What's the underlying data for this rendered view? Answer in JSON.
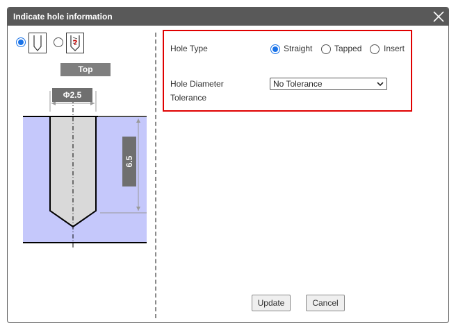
{
  "dialog": {
    "title": "Indicate hole information",
    "close_icon": "close-icon"
  },
  "left_panel": {
    "view_options": [
      {
        "icon": "straight-hole-icon",
        "selected": true
      },
      {
        "icon": "tapped-hole-icon",
        "selected": false
      }
    ],
    "view_label": "Top",
    "diameter_label": "Φ2.5",
    "depth_label": "6.5",
    "colors": {
      "material": "#c5c8fb",
      "hole": "#d9d9d9"
    }
  },
  "hole_type": {
    "label": "Hole Type",
    "options": [
      "Straight",
      "Tapped",
      "Insert"
    ],
    "selected": "Straight"
  },
  "tolerance": {
    "label_line1": "Hole Diameter",
    "label_line2": "Tolerance",
    "selected": "No Tolerance"
  },
  "buttons": {
    "update": "Update",
    "cancel": "Cancel"
  },
  "colors": {
    "titlebar": "#595959",
    "highlight": "#e00000",
    "radio_accent": "#1a73e8"
  }
}
